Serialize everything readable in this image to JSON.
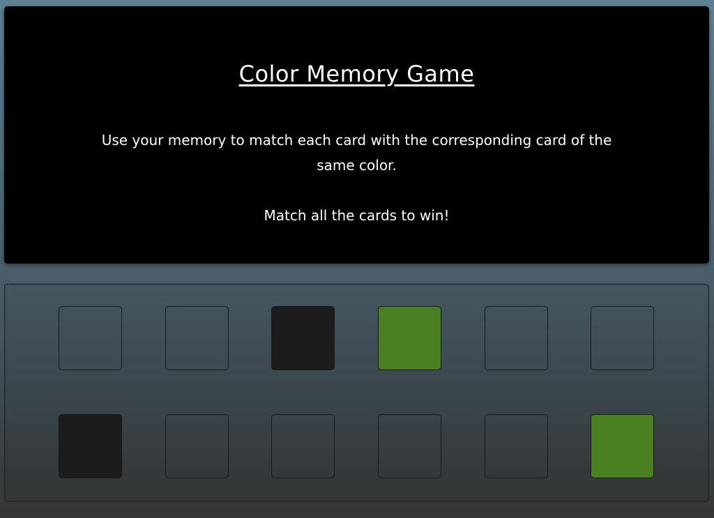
{
  "header": {
    "title": "Color Memory Game",
    "description": "Use your memory to match each card with the corresponding card of the same color.",
    "win_text": "Match all the cards to win!"
  },
  "colors": {
    "header_bg": "#000000",
    "face_down": "transparent",
    "black_card": "#1c1c1c",
    "green_card": "#4a8021",
    "card_border": "#161a1e"
  },
  "board": {
    "rows": [
      [
        {
          "state": "face-down",
          "color": null
        },
        {
          "state": "face-down",
          "color": null
        },
        {
          "state": "revealed",
          "color": "black"
        },
        {
          "state": "revealed",
          "color": "green"
        },
        {
          "state": "face-down",
          "color": null
        },
        {
          "state": "face-down",
          "color": null
        }
      ],
      [
        {
          "state": "revealed",
          "color": "black"
        },
        {
          "state": "face-down",
          "color": null
        },
        {
          "state": "face-down",
          "color": null
        },
        {
          "state": "face-down",
          "color": null
        },
        {
          "state": "face-down",
          "color": null
        },
        {
          "state": "revealed",
          "color": "green"
        }
      ]
    ]
  }
}
